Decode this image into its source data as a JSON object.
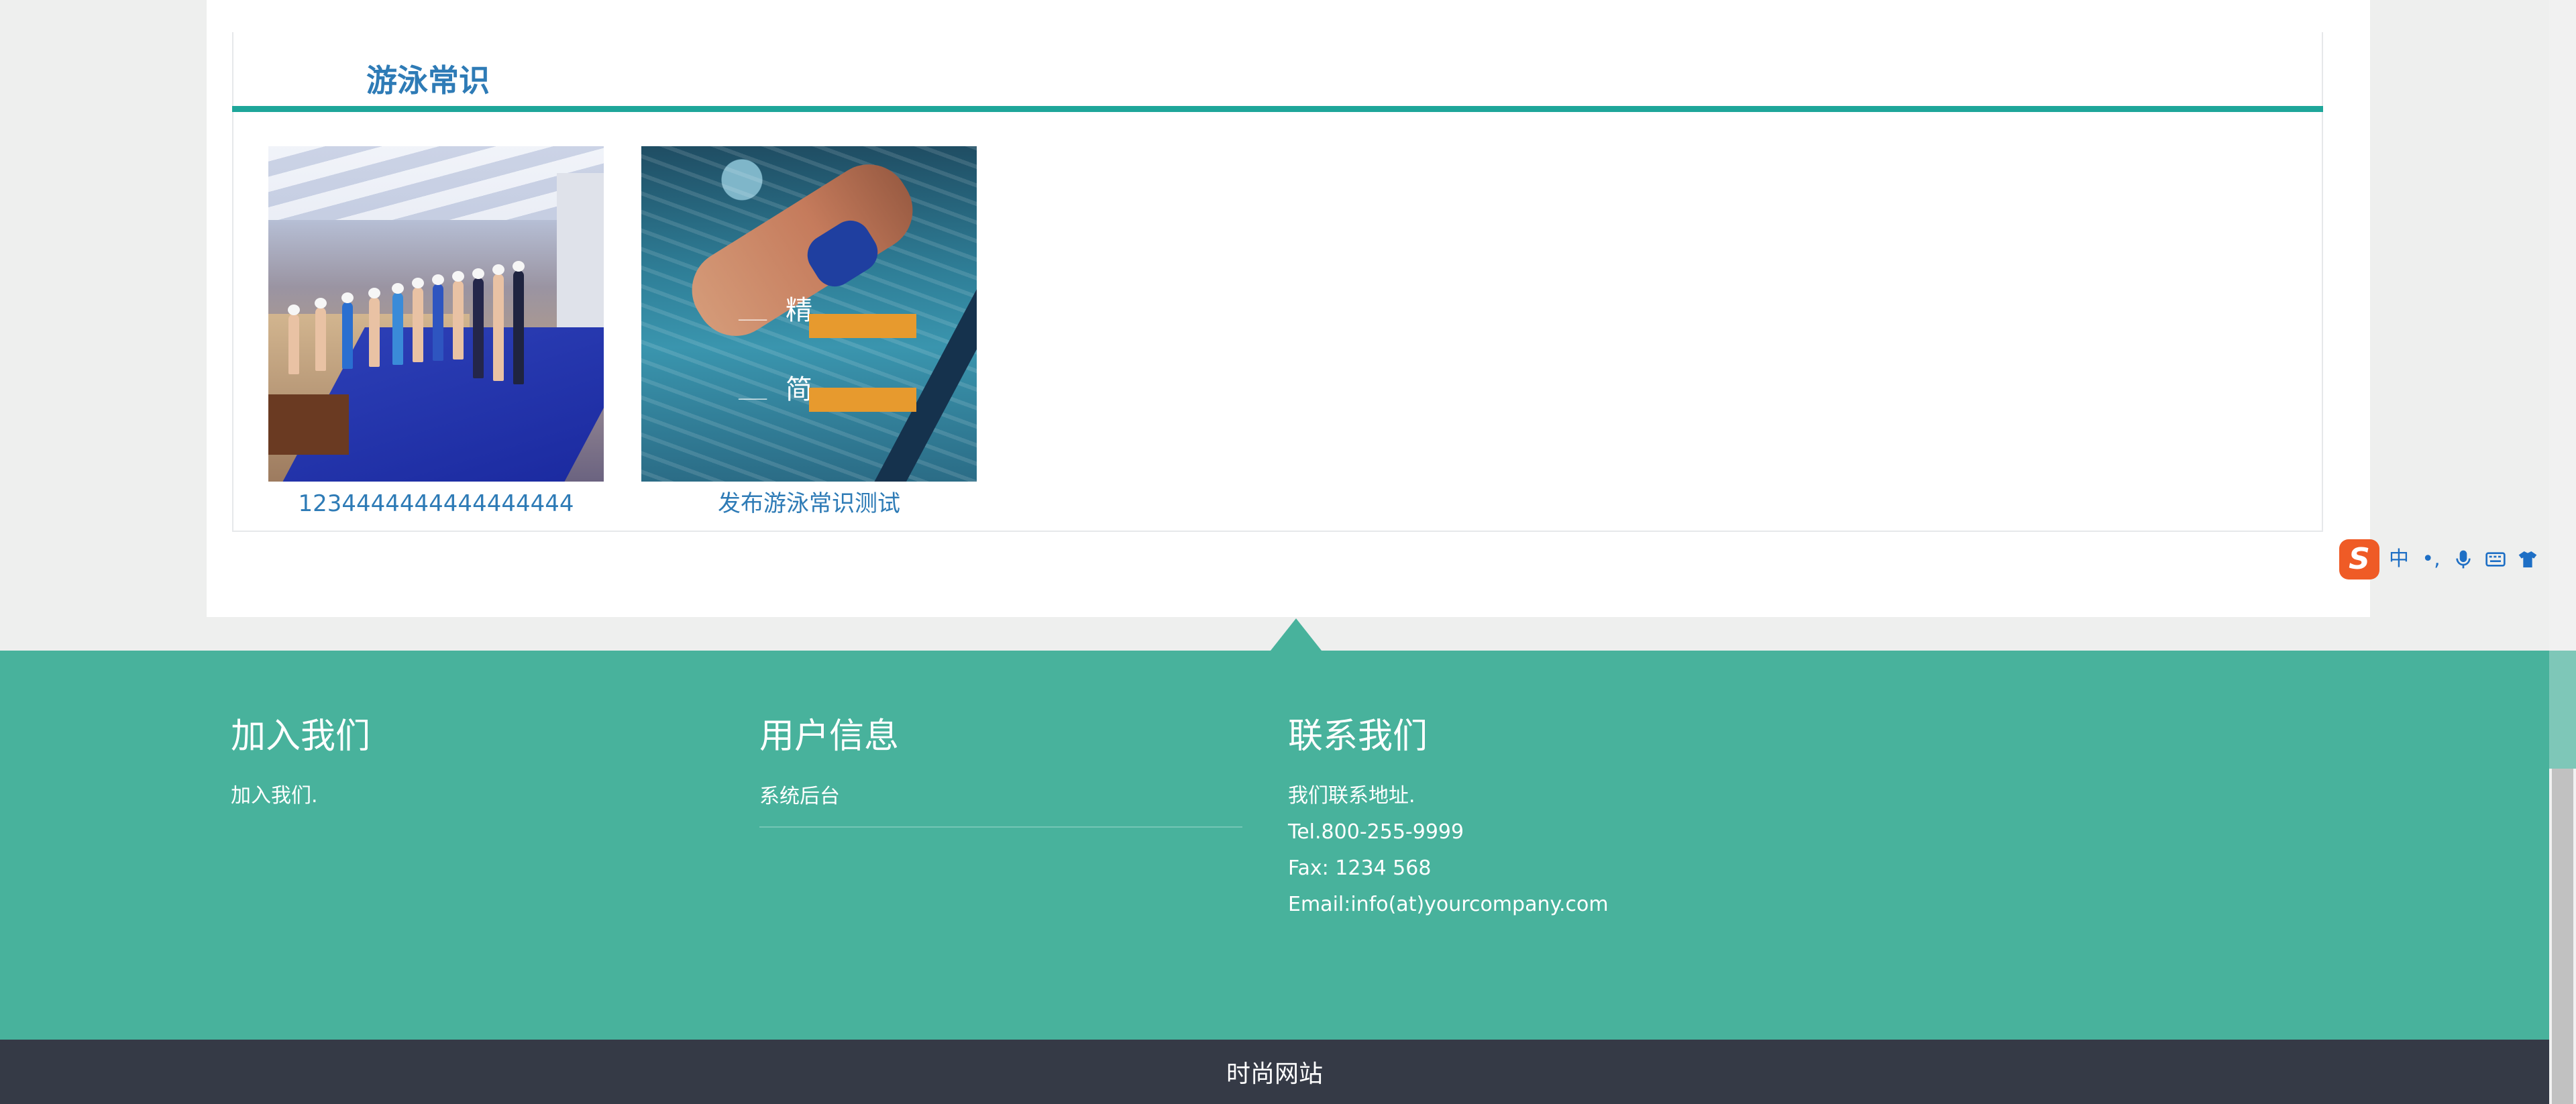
{
  "knowledge": {
    "title": "游泳常识",
    "articles": [
      {
        "caption": "1234444444444444444",
        "thumb": "indoor-pool-photo"
      },
      {
        "caption": "发布游泳常识测试",
        "thumb": "underwater-swimmer-poster",
        "poster_big_1": "精",
        "poster_big_2": "简"
      }
    ]
  },
  "ime": {
    "logo": "S",
    "mode": "中",
    "punct": "•,",
    "icons": [
      "microphone-icon",
      "keyboard-icon",
      "skin-icon",
      "apps-grid-icon"
    ]
  },
  "footer": {
    "join": {
      "heading": "加入我们",
      "text": "加入我们."
    },
    "user": {
      "heading": "用户信息",
      "link": "系统后台"
    },
    "contact": {
      "heading": "联系我们",
      "address": "我们联系地址.",
      "tel": "Tel.800-255-9999",
      "fax": "Fax: 1234 568",
      "email": "Email:info(at)yourcompany.com"
    },
    "bottom_title": "时尚网站"
  },
  "colors": {
    "accent_teal": "#1ea69a",
    "footer_green": "#48b29c",
    "bottom_bar": "#353a46",
    "link_blue": "#2e7bb6",
    "ime_orange": "#ef5b26"
  }
}
